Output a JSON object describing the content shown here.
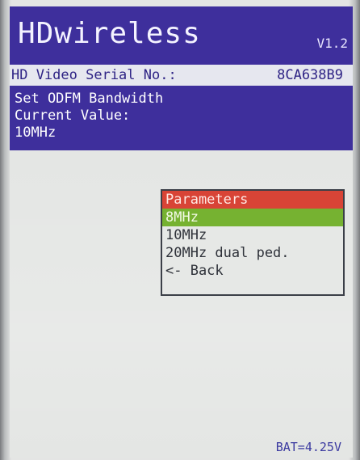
{
  "header": {
    "title": "HDwireless",
    "version": "V1.2",
    "serial_label": "HD Video Serial No.:",
    "serial_value": "8CA638B9"
  },
  "info": {
    "line1": "Set ODFM Bandwidth",
    "line2": "Current Value:",
    "line3": "10MHz"
  },
  "menu": {
    "header": "Parameters",
    "items": [
      {
        "label": "8MHz",
        "selected": true
      },
      {
        "label": "10MHz",
        "selected": false
      },
      {
        "label": "20MHz dual ped.",
        "selected": false
      },
      {
        "label": "<- Back",
        "selected": false
      }
    ]
  },
  "status": {
    "battery": "BAT=4.25V"
  },
  "colors": {
    "header_bg": "#3e2f9c",
    "menu_header_bg": "#d84436",
    "menu_selected_bg": "#76b231",
    "screen_bg": "#e4e6e4"
  }
}
